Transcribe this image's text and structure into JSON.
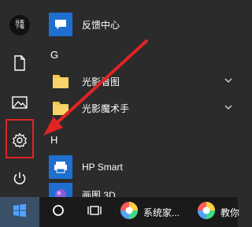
{
  "rail": {
    "avatar_text": "当客\n下载",
    "items": [
      {
        "icon": "document-icon"
      },
      {
        "icon": "pictures-icon"
      },
      {
        "icon": "gear-icon"
      },
      {
        "icon": "power-icon"
      }
    ]
  },
  "apps": {
    "entries": [
      {
        "label": "反馈中心",
        "icon": "feedback-hub-icon",
        "color": "#1e6fd0"
      },
      {
        "letter": "G"
      },
      {
        "label": "光影看图",
        "icon": "folder-icon",
        "color": "#f2c84b",
        "expandable": true
      },
      {
        "label": "光影魔术手",
        "icon": "folder-icon",
        "color": "#f2c84b",
        "expandable": true
      },
      {
        "letter": "H"
      },
      {
        "label": "HP Smart",
        "icon": "hp-smart-icon",
        "color": "#1e6fd0"
      },
      {
        "label": "画图 3D",
        "icon": "paint-3d-icon",
        "color": "#8a5bd6"
      }
    ]
  },
  "taskbar": {
    "items": [
      {
        "label": "",
        "icon": "windows-start-icon"
      },
      {
        "label": "",
        "icon": "cortana-circle-icon"
      },
      {
        "label": "",
        "icon": "task-view-icon"
      },
      {
        "label": "系统家...",
        "icon": "colorful-app-icon"
      },
      {
        "label": "教你",
        "icon": "colorful-app-icon"
      }
    ]
  },
  "accent_color": "#e02424"
}
